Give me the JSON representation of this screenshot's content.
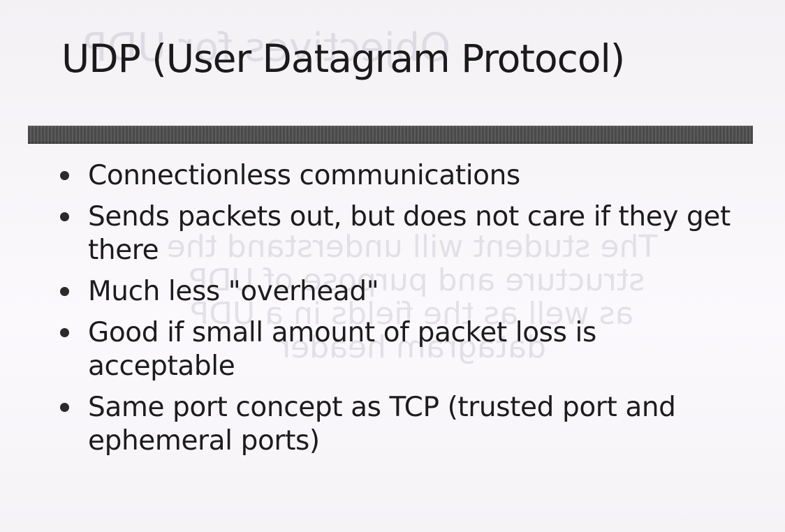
{
  "slide": {
    "title": "UDP (User Datagram Protocol)",
    "bullets": [
      "Connectionless communications",
      "Sends packets out, but does not care if they get there",
      "Much less \"overhead\"",
      "Good if small amount of packet loss is acceptable",
      "Same port concept as TCP (trusted port and ephemeral ports)"
    ]
  },
  "bleed_through": {
    "title": "Objectives for UDP",
    "body": "The student will understand the structure and purpose of UDP, as well as the fields in a UDP datagram header"
  },
  "colors": {
    "background": "#f7f4f8",
    "text": "#1a1a1a",
    "rule": "#4a4a4a"
  }
}
